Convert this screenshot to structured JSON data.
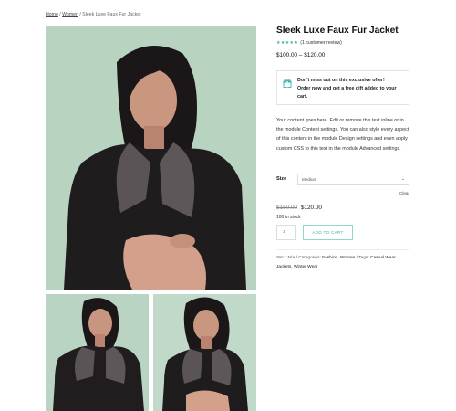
{
  "breadcrumb": {
    "home": "Home",
    "sep1": " / ",
    "women": "Women",
    "sep2": " / ",
    "current": "Sleek Luxe Faux Fur Jacket"
  },
  "product": {
    "title": "Sleek Luxe Faux Fur Jacket",
    "stars": "★★★★★",
    "rating": 5,
    "review_text": "(1 customer review)",
    "price_range": "$100.00 – $120.00"
  },
  "promo": {
    "line1": "Don't miss out on this exclusive offer!",
    "line2": "Order now and get a free gift added to your",
    "line3": "cart.",
    "icon": "gift-icon"
  },
  "description": "Your content goes here. Edit or remove this text inline or in the module Content settings. You can also style every aspect of this content in the module Design settings and even apply custom CSS to this text in the module Advanced settings.",
  "size": {
    "label": "Size",
    "selected": "Medium",
    "clear": "Clear"
  },
  "pricing": {
    "old_price": "$150.00",
    "new_price": "$120.00",
    "stock": "100 in stock"
  },
  "cart": {
    "quantity": "1",
    "button": "ADD TO CART"
  },
  "meta": {
    "sku_label": "SKU: ",
    "sku_value": "N/A",
    "categories_label": " / Categories: ",
    "cat1": "Fashion",
    "comma1": ", ",
    "cat2": "Women",
    "tags_label": " / Tags: ",
    "tag1": "Casual Wear",
    "comma2": ", ",
    "tag2": "Jackets",
    "comma3": ", ",
    "tag3": "Winter Wear"
  },
  "colors": {
    "accent": "#3cb3a6",
    "photo_background": "#b8d3c0",
    "jacket": "#1f1c1e"
  }
}
